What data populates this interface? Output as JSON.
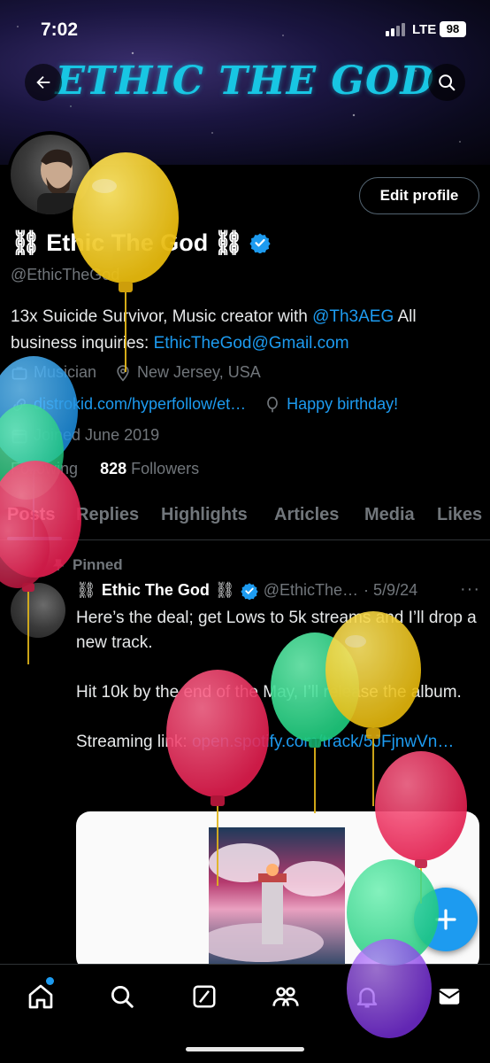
{
  "status_bar": {
    "time": "7:02",
    "network": "LTE",
    "battery": "98"
  },
  "banner": {
    "brand": "ETHIC THE GOD"
  },
  "profile": {
    "edit_label": "Edit profile",
    "name": "Ethic The God",
    "handle": "@EthicTheGod",
    "bio_prefix": "13x Suicide Survivor, Music creator with ",
    "bio_mention": "@Th3AEG",
    "bio_middle": " All business inquiries: ",
    "bio_email": "EthicTheGod@Gmail.com",
    "category": "Musician",
    "location": "New Jersey, USA",
    "website": "distrokid.com/hyperfollow/et…",
    "birthday": "Happy birthday!",
    "joined": "Joined June 2019",
    "following_label": "Following",
    "followers_count": "828",
    "followers_label": "Followers"
  },
  "tabs": [
    "Posts",
    "Replies",
    "Highlights",
    "Articles",
    "Media",
    "Likes"
  ],
  "post": {
    "pinned_label": "Pinned",
    "name": "Ethic The God",
    "handle": "@EthicThe…",
    "date": "· 5/9/24",
    "more": "···",
    "text_main": "Here’s the deal; get Lows to 5k streams and I’ll drop a new track.\n\nHit 10k by the end of the May, I’ll release the album.\n\nStreaming link: ",
    "text_link": "open.spotify.com/track/5JFjnwVn…"
  },
  "nav": [
    "home-icon",
    "search-icon",
    "grok-icon",
    "communities-icon",
    "notifications-icon",
    "messages-icon"
  ],
  "colors": {
    "accent": "#1d9bf0",
    "brand": "#18c6e3",
    "background": "#000000",
    "muted": "#71767b"
  }
}
